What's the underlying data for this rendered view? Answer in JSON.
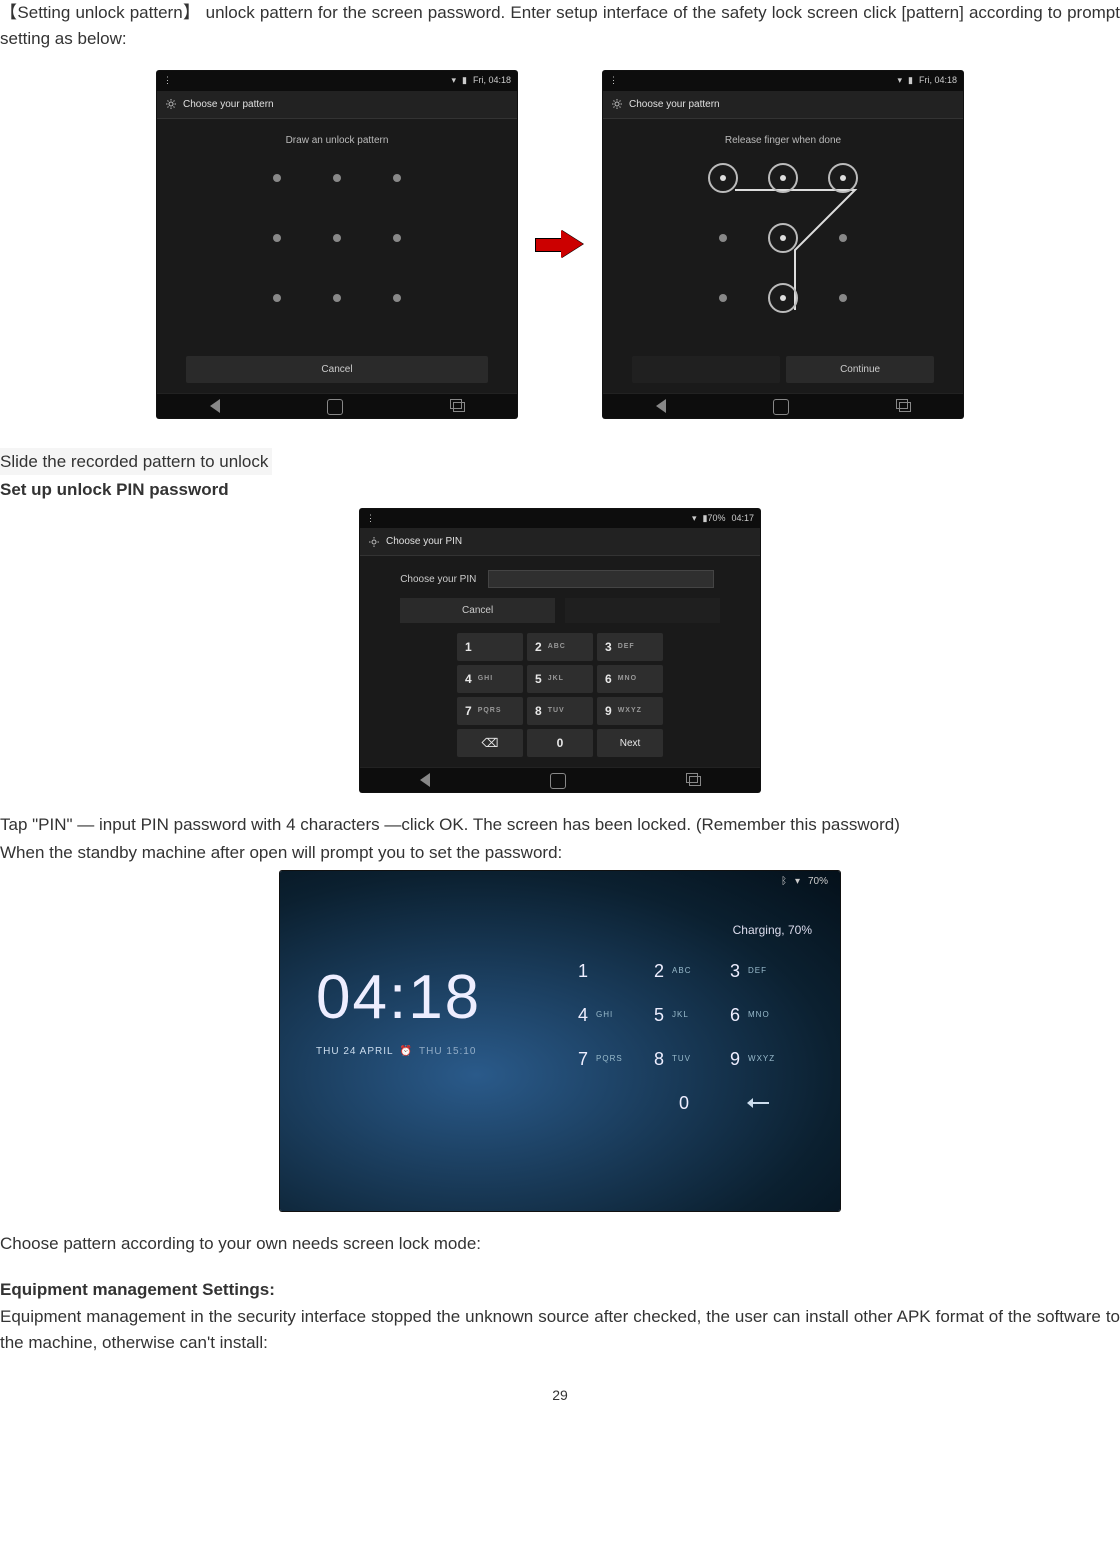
{
  "intro_bracket": "【Setting unlock pattern】",
  "intro_rest": "unlock pattern for the screen password. Enter setup interface of the safety lock screen click [pattern] according to prompt setting as below:",
  "slide_note": "Slide the recorded pattern to unlock",
  "pin_heading": "Set up unlock PIN password",
  "pin_para": "Tap \"PIN\" — input PIN password with 4 characters —click OK. The screen has been locked. (Remember this password)",
  "pin_para2": "When the standby machine after open will prompt you to set the password:",
  "choose_para": "Choose pattern according to your own needs screen lock mode:",
  "equip_heading": "Equipment management Settings:",
  "equip_para": "Equipment management in the security interface stopped the unknown source after checked, the user can install other APK format of the software to the machine, otherwise can't install:",
  "page_number": "29",
  "device_common": {
    "status_time": "Fri, 04:18",
    "choose_pattern_title": "Choose your pattern",
    "choose_pin_title": "Choose your PIN",
    "draw_hint": "Draw an unlock pattern",
    "release_hint": "Release finger when done",
    "cancel": "Cancel",
    "continue": "Continue",
    "choose_pin_label": "Choose your PIN",
    "next": "Next"
  },
  "keypad": {
    "k1": {
      "n": "1",
      "s": ""
    },
    "k2": {
      "n": "2",
      "s": "ABC"
    },
    "k3": {
      "n": "3",
      "s": "DEF"
    },
    "k4": {
      "n": "4",
      "s": "GHI"
    },
    "k5": {
      "n": "5",
      "s": "JKL"
    },
    "k6": {
      "n": "6",
      "s": "MNO"
    },
    "k7": {
      "n": "7",
      "s": "PQRS"
    },
    "k8": {
      "n": "8",
      "s": "TUV"
    },
    "k9": {
      "n": "9",
      "s": "WXYZ"
    },
    "k0": {
      "n": "0",
      "s": ""
    },
    "del": "⌫"
  },
  "lockscreen": {
    "status_batt": "70%",
    "time": "04:18",
    "date_main": "THU 24 APRIL",
    "date_dup": "THU 15:10",
    "charging": "Charging, 70%"
  }
}
